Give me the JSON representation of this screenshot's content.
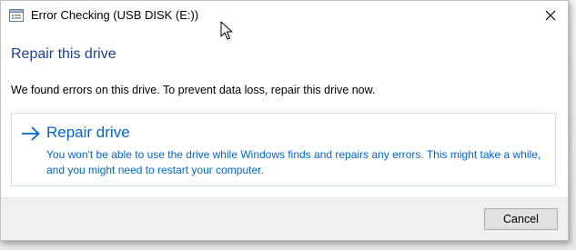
{
  "window": {
    "title": "Error Checking (USB DISK (E:))"
  },
  "dialog": {
    "heading": "Repair this drive",
    "message": "We found errors on this drive. To prevent data loss, repair this drive now.",
    "option": {
      "title": "Repair drive",
      "description": "You won't be able to use the drive while Windows finds and repairs any errors. This might take a while, and you might need to restart your computer."
    }
  },
  "footer": {
    "cancel_label": "Cancel"
  },
  "icons": {
    "title_icon": "drive-properties-icon",
    "close": "close-icon",
    "arrow": "arrow-right-icon",
    "cursor": "mouse-pointer-icon"
  },
  "colors": {
    "heading": "#1f3f98",
    "link_blue": "#0066cc",
    "option_border": "#cfe3f4",
    "footer_bg": "#f0f0f0",
    "button_bg": "#e1e1e1"
  }
}
